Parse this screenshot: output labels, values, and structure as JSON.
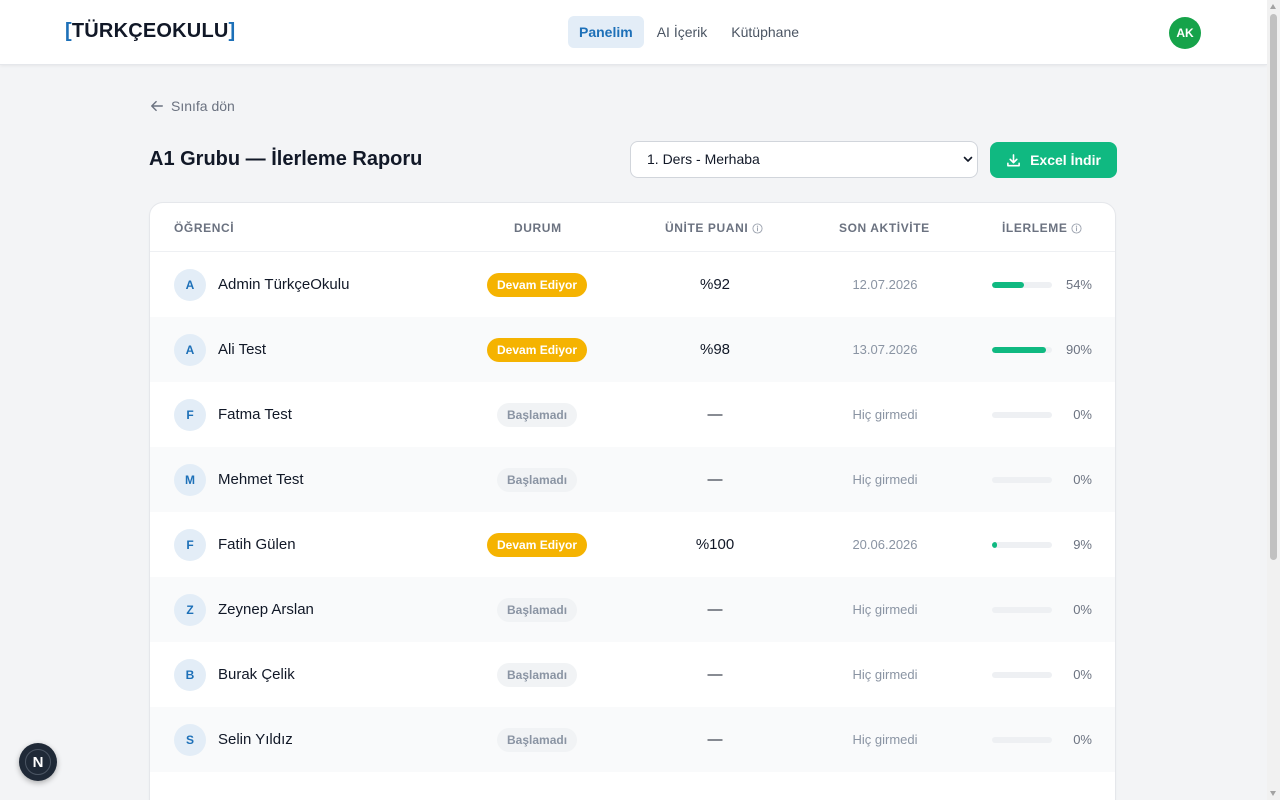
{
  "brand": {
    "bracket_open": "[",
    "name": "TÜRKÇEOKULU",
    "bracket_close": "]"
  },
  "nav": {
    "items": [
      "Panelim",
      "AI İçerik",
      "Kütüphane"
    ],
    "active": "Panelim"
  },
  "user": {
    "initials": "AK"
  },
  "back": {
    "label": "Sınıfa dön"
  },
  "page": {
    "title": "A1 Grubu — İlerleme Raporu"
  },
  "lesson_select": {
    "value": "1. Ders - Merhaba"
  },
  "export": {
    "label": "Excel İndir"
  },
  "table": {
    "headers": {
      "student": "ÖĞRENCİ",
      "status": "DURUM",
      "score": "ÜNİTE PUANI",
      "last_activity": "SON AKTİVİTE",
      "progress": "İLERLEME"
    },
    "rows": [
      {
        "initial": "A",
        "name": "Admin TürkçeOkulu",
        "status": "Devam Ediyor",
        "status_kind": "in-progress",
        "score": "%92",
        "last": "12.07.2026",
        "progress": 54,
        "progress_label": "54%"
      },
      {
        "initial": "A",
        "name": "Ali Test",
        "status": "Devam Ediyor",
        "status_kind": "in-progress",
        "score": "%98",
        "last": "13.07.2026",
        "progress": 90,
        "progress_label": "90%"
      },
      {
        "initial": "F",
        "name": "Fatma Test",
        "status": "Başlamadı",
        "status_kind": "not-started",
        "score": "—",
        "last": "Hiç girmedi",
        "progress": 0,
        "progress_label": "0%"
      },
      {
        "initial": "M",
        "name": "Mehmet Test",
        "status": "Başlamadı",
        "status_kind": "not-started",
        "score": "—",
        "last": "Hiç girmedi",
        "progress": 0,
        "progress_label": "0%"
      },
      {
        "initial": "F",
        "name": "Fatih Gülen",
        "status": "Devam Ediyor",
        "status_kind": "in-progress",
        "score": "%100",
        "last": "20.06.2026",
        "progress": 9,
        "progress_label": "9%"
      },
      {
        "initial": "Z",
        "name": "Zeynep Arslan",
        "status": "Başlamadı",
        "status_kind": "not-started",
        "score": "—",
        "last": "Hiç girmedi",
        "progress": 0,
        "progress_label": "0%"
      },
      {
        "initial": "B",
        "name": "Burak Çelik",
        "status": "Başlamadı",
        "status_kind": "not-started",
        "score": "—",
        "last": "Hiç girmedi",
        "progress": 0,
        "progress_label": "0%"
      },
      {
        "initial": "S",
        "name": "Selin Yıldız",
        "status": "Başlamadı",
        "status_kind": "not-started",
        "score": "—",
        "last": "Hiç girmedi",
        "progress": 0,
        "progress_label": "0%"
      }
    ]
  },
  "dev_badge": {
    "letter": "N"
  },
  "colors": {
    "brand_blue": "#1d70b8",
    "success_green": "#10b981",
    "status_amber": "#f5b301",
    "avatar_green": "#16a34a"
  },
  "icons": {
    "back": "arrow-left-icon",
    "export": "download-icon",
    "info": "info-circle-icon",
    "select": "chevron-down-icon"
  }
}
